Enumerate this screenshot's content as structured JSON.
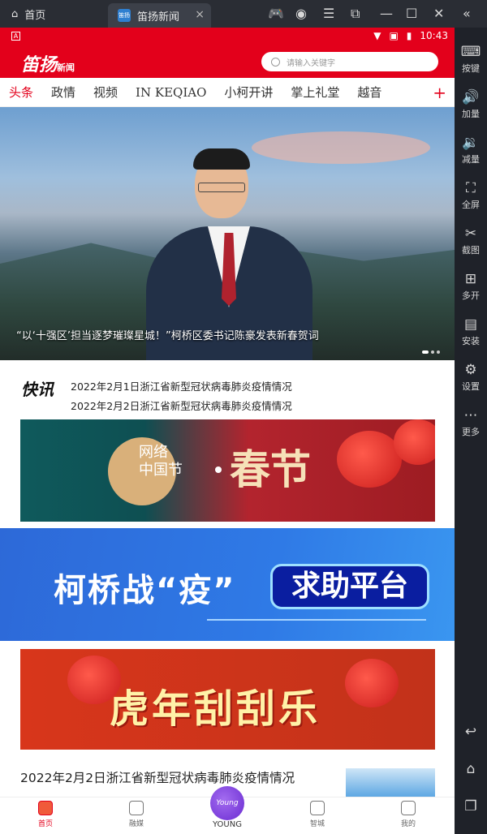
{
  "window": {
    "home_label": "首页",
    "tab_title": "笛扬新闻",
    "tab_logo": "笛扬",
    "home_icon": "home-icon",
    "close_tab": "×"
  },
  "status_bar": {
    "time": "10:43",
    "corner": "A"
  },
  "app_header": {
    "brand": "笛扬",
    "brand_sub": "新闻",
    "search_placeholder": "请输入关键字"
  },
  "nav_tabs": [
    "头条",
    "政情",
    "视频",
    "IN KEQIAO",
    "小柯开讲",
    "掌上礼堂",
    "越音"
  ],
  "nav_plus": "+",
  "hero": {
    "caption": "“以‘十强区’担当逐梦璀璨星城！”柯桥区委书记陈豪发表新春贺词"
  },
  "flash": {
    "logo": "快讯",
    "items": [
      "2022年2月1日浙江省新型冠状病毒肺炎疫情情况",
      "2022年2月2日浙江省新型冠状病毒肺炎疫情情况"
    ]
  },
  "banners": {
    "festival_circle": "网络\n中国节",
    "festival_title": "春节",
    "epidemic_title": "柯桥战“疫”",
    "epidemic_button": "求助平台",
    "lottery_title": "虎年刮刮乐"
  },
  "news": {
    "title": "2022年2月2日浙江省新型冠状病毒肺炎疫情情况"
  },
  "bottom_nav": [
    {
      "label": "首页",
      "icon": "news-icon"
    },
    {
      "label": "融媒",
      "icon": "media-icon"
    },
    {
      "label": "YOUNG",
      "icon": "young-icon"
    },
    {
      "label": "智城",
      "icon": "smart-city-icon"
    },
    {
      "label": "我的",
      "icon": "profile-icon"
    }
  ],
  "young_badge": "Young",
  "emulator_sidebar": [
    {
      "label": "按键",
      "icon": "keyboard-icon"
    },
    {
      "label": "加量",
      "icon": "volume-up-icon"
    },
    {
      "label": "减量",
      "icon": "volume-down-icon"
    },
    {
      "label": "全屏",
      "icon": "fullscreen-icon"
    },
    {
      "label": "截图",
      "icon": "scissors-icon"
    },
    {
      "label": "多开",
      "icon": "multi-instance-icon"
    },
    {
      "label": "安装",
      "icon": "apk-icon"
    },
    {
      "label": "设置",
      "icon": "gear-icon"
    },
    {
      "label": "更多",
      "icon": "more-icon"
    }
  ],
  "colors": {
    "brand_red": "#e3001b",
    "chrome_dark": "#1f2229"
  }
}
